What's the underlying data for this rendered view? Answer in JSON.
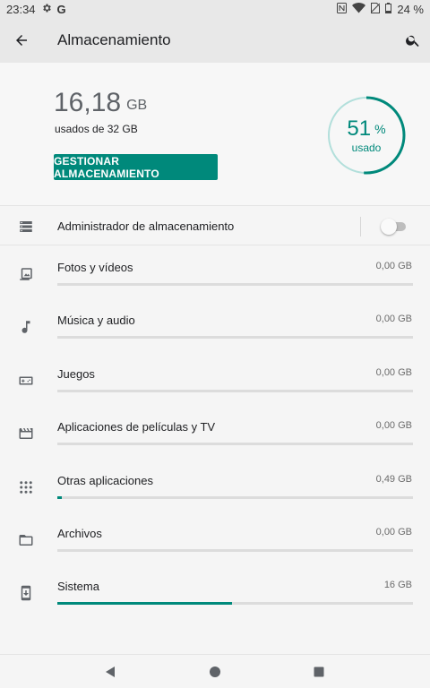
{
  "status_bar": {
    "time": "23:34",
    "battery": "24 %",
    "icons": [
      "settings-icon",
      "google-g-icon",
      "nfc-icon",
      "wifi-icon",
      "no-sim-icon",
      "battery-icon"
    ],
    "google_letter": "G"
  },
  "app_bar": {
    "title": "Almacenamiento",
    "icons": [
      "back-arrow-icon",
      "search-icon"
    ]
  },
  "summary": {
    "used_value": "16,18",
    "used_unit": "GB",
    "used_of": "usados de 32 GB",
    "manage_button": "GESTIONAR ALMACENAMIENTO",
    "percent": "51",
    "percent_symbol": "%",
    "percent_label": "usado",
    "percent_fraction": 0.51,
    "accent_color": "#00897b"
  },
  "manager": {
    "label": "Administrador de almacenamiento",
    "enabled": false,
    "icon": "storage-manager-icon"
  },
  "categories": [
    {
      "label": "Fotos y vídeos",
      "size": "0,00 GB",
      "fraction": 0,
      "icon": "photo-icon"
    },
    {
      "label": "Música y audio",
      "size": "0,00 GB",
      "fraction": 0,
      "icon": "music-note-icon"
    },
    {
      "label": "Juegos",
      "size": "0,00 GB",
      "fraction": 0,
      "icon": "gamepad-icon"
    },
    {
      "label": "Aplicaciones de películas y TV",
      "size": "0,00 GB",
      "fraction": 0,
      "icon": "movie-icon"
    },
    {
      "label": "Otras aplicaciones",
      "size": "0,49 GB",
      "fraction": 0.012,
      "icon": "apps-grid-icon"
    },
    {
      "label": "Archivos",
      "size": "0,00 GB",
      "fraction": 0,
      "icon": "folder-icon"
    },
    {
      "label": "Sistema",
      "size": "16 GB",
      "fraction": 0.49,
      "icon": "system-update-icon"
    }
  ],
  "nav_bar": {
    "icons": [
      "nav-back-icon",
      "nav-home-icon",
      "nav-recents-icon"
    ]
  }
}
